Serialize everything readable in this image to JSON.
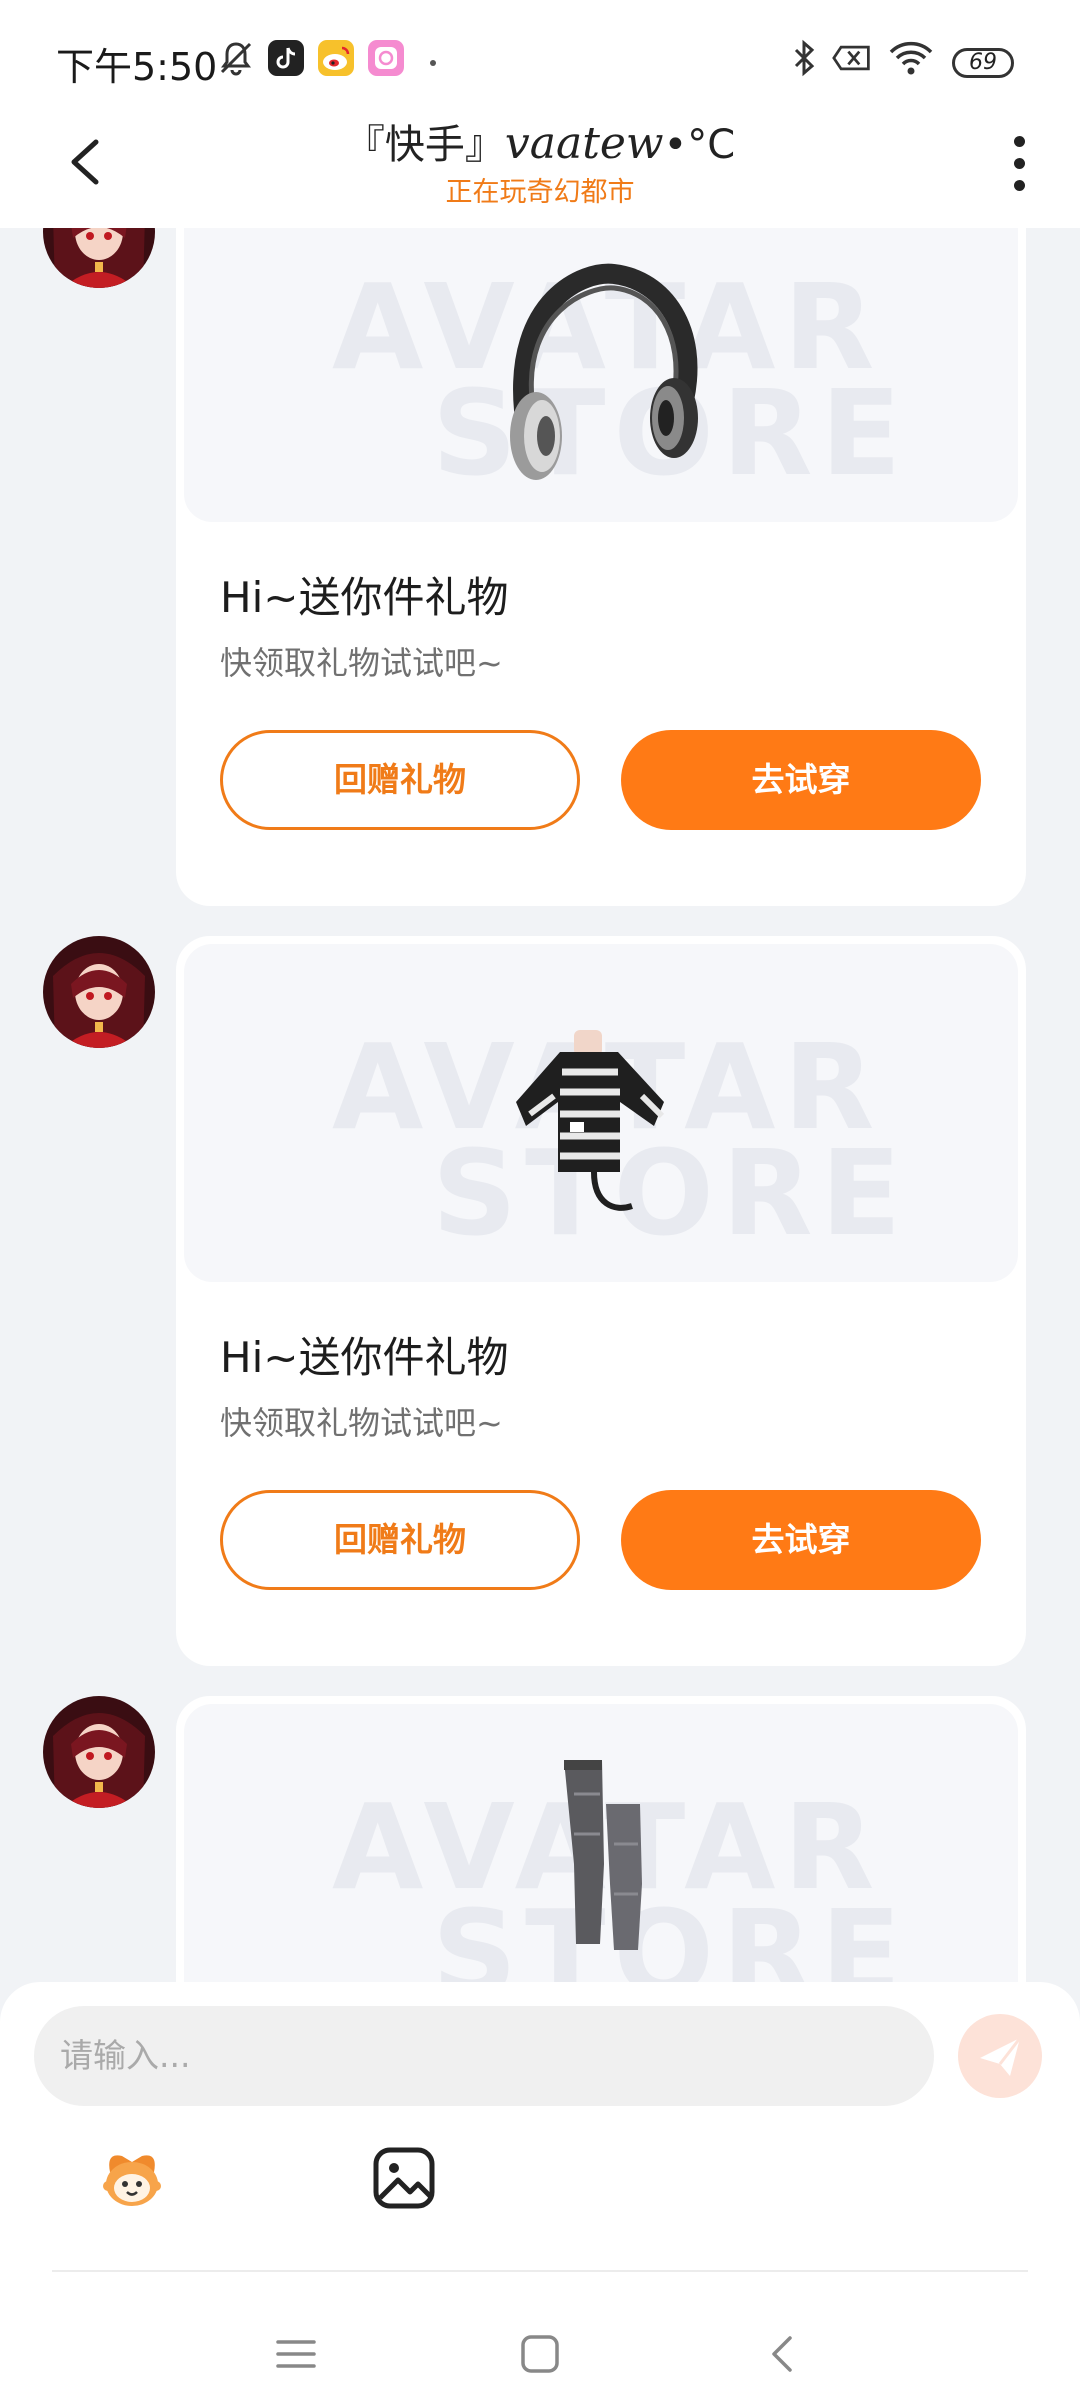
{
  "status_bar": {
    "time": "下午5:50",
    "battery": "69",
    "icons": [
      "bell-off-icon",
      "tiktok-icon",
      "weibo-icon",
      "camera-app-icon",
      "bluetooth-icon",
      "sim-x-icon",
      "wifi-icon",
      "battery-icon"
    ]
  },
  "header": {
    "title": "『快手』",
    "title_signature": "vaatew",
    "title_suffix": "•°C",
    "subtitle": "正在玩奇幻都市",
    "back_icon": "chevron-left-icon",
    "more_icon": "more-vertical-icon"
  },
  "messages": [
    {
      "item": "headphones",
      "watermark_line1": "AVATAR",
      "watermark_line2": "STORE",
      "title": "Hi~送你件礼物",
      "desc": "快领取礼物试试吧~",
      "btn_return": "回赠礼物",
      "btn_try": "去试穿"
    },
    {
      "item": "striped-sweater",
      "watermark_line1": "AVATAR",
      "watermark_line2": "STORE",
      "title": "Hi~送你件礼物",
      "desc": "快领取礼物试试吧~",
      "btn_return": "回赠礼物",
      "btn_try": "去试穿"
    },
    {
      "item": "jeans-boots",
      "watermark_line1": "AVATAR",
      "watermark_line2": "STORE"
    }
  ],
  "input": {
    "placeholder": "请输入..."
  },
  "colors": {
    "accent": "#ff7a15",
    "accent_text": "#f07b18",
    "background": "#f1f3f6"
  }
}
